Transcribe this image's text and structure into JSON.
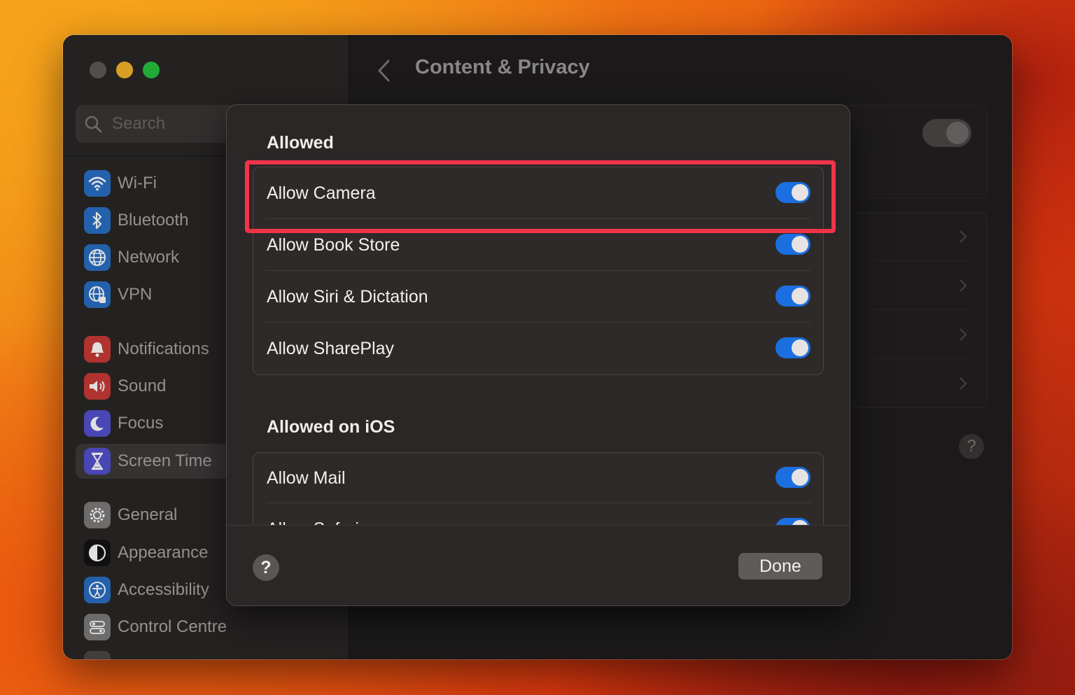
{
  "window": {
    "title": "Content & Privacy",
    "traffic_lights": [
      "close",
      "minimize",
      "maximize"
    ]
  },
  "sidebar": {
    "search": {
      "placeholder": "Search",
      "icon": "search-icon"
    },
    "items": [
      {
        "label": "Wi-Fi",
        "icon": "wifi-icon",
        "color": "#2a7bd8"
      },
      {
        "label": "Bluetooth",
        "icon": "bluetooth-icon",
        "color": "#2a7bd8"
      },
      {
        "label": "Network",
        "icon": "globe-icon",
        "color": "#2a7bd8"
      },
      {
        "label": "VPN",
        "icon": "vpn-icon",
        "color": "#2a7bd8"
      },
      {
        "label": "Notifications",
        "icon": "bell-icon",
        "color": "#d9443f"
      },
      {
        "label": "Sound",
        "icon": "speaker-icon",
        "color": "#d9443f"
      },
      {
        "label": "Focus",
        "icon": "moon-icon",
        "color": "#5856d6"
      },
      {
        "label": "Screen Time",
        "icon": "hourglass-icon",
        "color": "#5856d6",
        "selected": true
      },
      {
        "label": "General",
        "icon": "gear-icon",
        "color": "#8e8e93"
      },
      {
        "label": "Appearance",
        "icon": "appearance-icon",
        "color": "#1c1c1e"
      },
      {
        "label": "Accessibility",
        "icon": "accessibility-icon",
        "color": "#2a7bd8"
      },
      {
        "label": "Control Centre",
        "icon": "control-centre-icon",
        "color": "#8e8e93"
      }
    ]
  },
  "sheet": {
    "sections": [
      {
        "title": "Allowed",
        "rows": [
          {
            "label": "Allow Camera",
            "on": true,
            "highlighted": true
          },
          {
            "label": "Allow Book Store",
            "on": true
          },
          {
            "label": "Allow Siri & Dictation",
            "on": true
          },
          {
            "label": "Allow SharePlay",
            "on": true
          }
        ]
      },
      {
        "title": "Allowed on iOS",
        "rows": [
          {
            "label": "Allow Mail",
            "on": true
          },
          {
            "label": "Allow Safari",
            "on": true
          }
        ]
      }
    ],
    "footer": {
      "help_label": "?",
      "done_label": "Done"
    }
  },
  "background_panel": {
    "help_label": "?"
  },
  "colors": {
    "toggle_on": "#1b6fe0",
    "highlight": "#f0344a"
  }
}
